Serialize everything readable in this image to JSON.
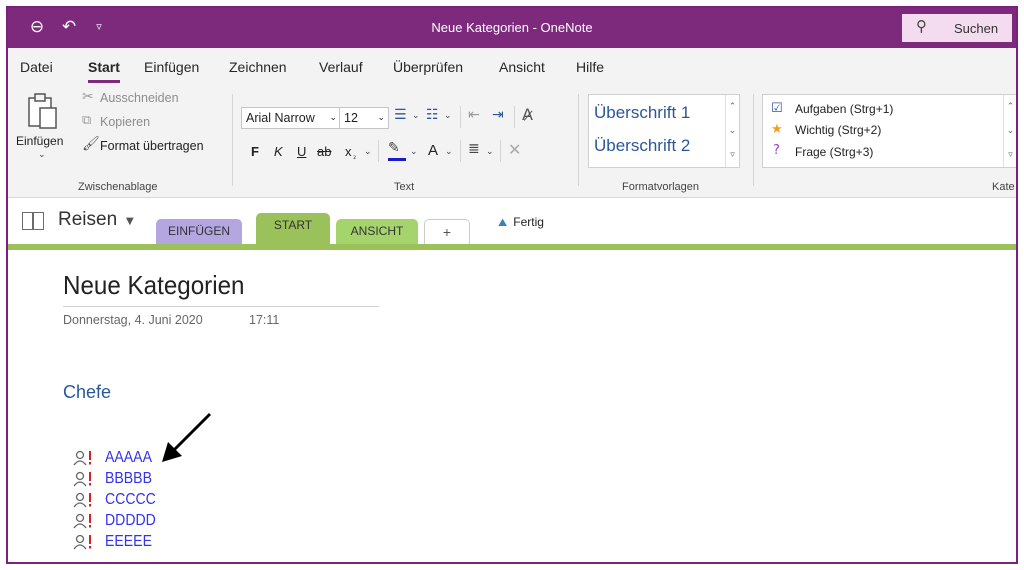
{
  "titlebar": {
    "title": "Neue Kategorien  -  OneNote",
    "search_label": "Suchen",
    "icons": [
      "back-icon",
      "undo-icon",
      "quick-access-dropdown-icon",
      "search-icon"
    ]
  },
  "menu": {
    "items": [
      "Datei",
      "Start",
      "Einfügen",
      "Zeichnen",
      "Verlauf",
      "Überprüfen",
      "Ansicht",
      "Hilfe"
    ],
    "active": "Start"
  },
  "ribbon": {
    "clipboard": {
      "paste_label": "Einfügen",
      "cut_label": "Ausschneiden",
      "copy_label": "Kopieren",
      "format_painter_label": "Format übertragen",
      "group_label": "Zwischenablage"
    },
    "text": {
      "font_name": "Arial Narrow",
      "font_size": "12",
      "bold": "F",
      "italic": "K",
      "underline": "U",
      "strike": "ab",
      "subscript": "x",
      "font_color": "A",
      "group_label": "Text"
    },
    "styles": {
      "heading1": "Überschrift 1",
      "heading2": "Überschrift 2",
      "group_label": "Formatvorlagen"
    },
    "tags": {
      "items": [
        "Aufgaben (Strg+1)",
        "Wichtig (Strg+2)",
        "Frage (Strg+3)"
      ],
      "group_label": "Kate"
    }
  },
  "notebook": {
    "name": "Reisen",
    "sections": [
      "EINFÜGEN",
      "START",
      "ANSICHT",
      "+"
    ],
    "active_section": "START",
    "done_label": "Fertig"
  },
  "page": {
    "title": "Neue Kategorien",
    "date": "Donnerstag, 4. Juni 2020",
    "time": "17:11",
    "heading": "Chefe",
    "items": [
      "AAAAA",
      "BBBBB",
      "CCCCC",
      "DDDDD",
      "EEEEE"
    ]
  },
  "colors": {
    "titlebar": "#7d2a7c",
    "ribbon_bg": "#f3f3f3",
    "section_einfuegen": "#b4a6e0",
    "section_start": "#9bc15b",
    "section_ansicht": "#a6d46c",
    "link_text": "#3333ee",
    "heading": "#2b5797",
    "tag_exclaim": "#d42020"
  }
}
